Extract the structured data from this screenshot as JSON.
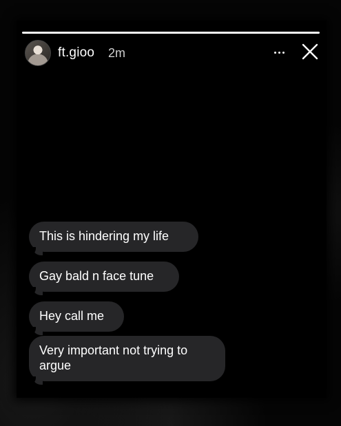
{
  "story": {
    "username": "ft.gioo",
    "timestamp": "2m",
    "icons": {
      "more": "more-horizontal-icon",
      "close": "close-icon",
      "avatar": "avatar"
    }
  },
  "messages": [
    {
      "text": "This is hindering my life"
    },
    {
      "text": "Gay bald n face tune"
    },
    {
      "text": "Hey call me"
    },
    {
      "text": "Very important not trying to argue"
    }
  ],
  "colors": {
    "background": "#000000",
    "bubble": "#262628",
    "text": "#ffffff"
  }
}
